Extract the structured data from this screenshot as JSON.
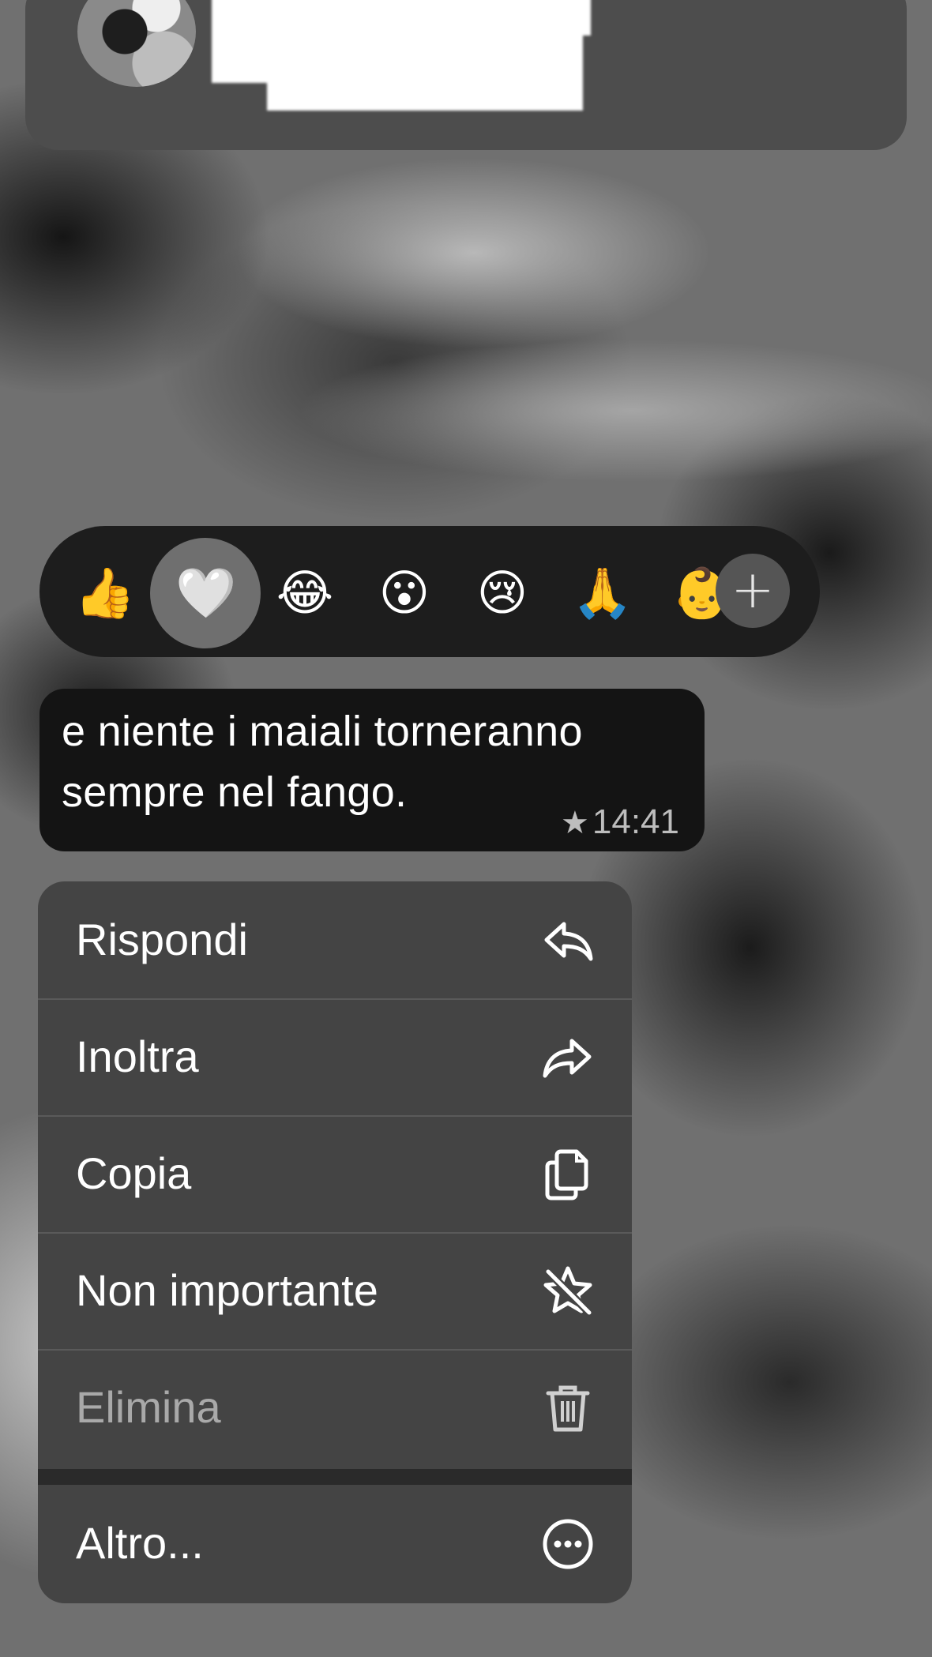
{
  "header": {
    "avatar_icon": "profile-photo",
    "name_redacted": true
  },
  "reactions": {
    "items": [
      {
        "name": "thumbs-up",
        "glyph": "👍"
      },
      {
        "name": "heart",
        "glyph": "🤍",
        "selected": true
      },
      {
        "name": "tears-of-joy",
        "glyph": "😂"
      },
      {
        "name": "surprised",
        "glyph": "😮"
      },
      {
        "name": "crying",
        "glyph": "😢"
      },
      {
        "name": "folded-hands",
        "glyph": "🙏"
      },
      {
        "name": "baby",
        "glyph": "👶"
      }
    ],
    "more_icon": "plus-icon",
    "more_glyph": "+"
  },
  "message": {
    "text_line1": "e niente i maiali torneranno",
    "text_line2": "sempre nel fango.",
    "starred_glyph": "★",
    "time": "14:41"
  },
  "menu": {
    "reply": {
      "label": "Rispondi",
      "icon": "reply-icon"
    },
    "forward": {
      "label": "Inoltra",
      "icon": "forward-icon"
    },
    "copy": {
      "label": "Copia",
      "icon": "copy-icon"
    },
    "unstar": {
      "label": "Non importante",
      "icon": "unstar-icon"
    },
    "delete": {
      "label": "Elimina",
      "icon": "trash-icon"
    },
    "more": {
      "label": "Altro...",
      "icon": "more-icon"
    }
  }
}
